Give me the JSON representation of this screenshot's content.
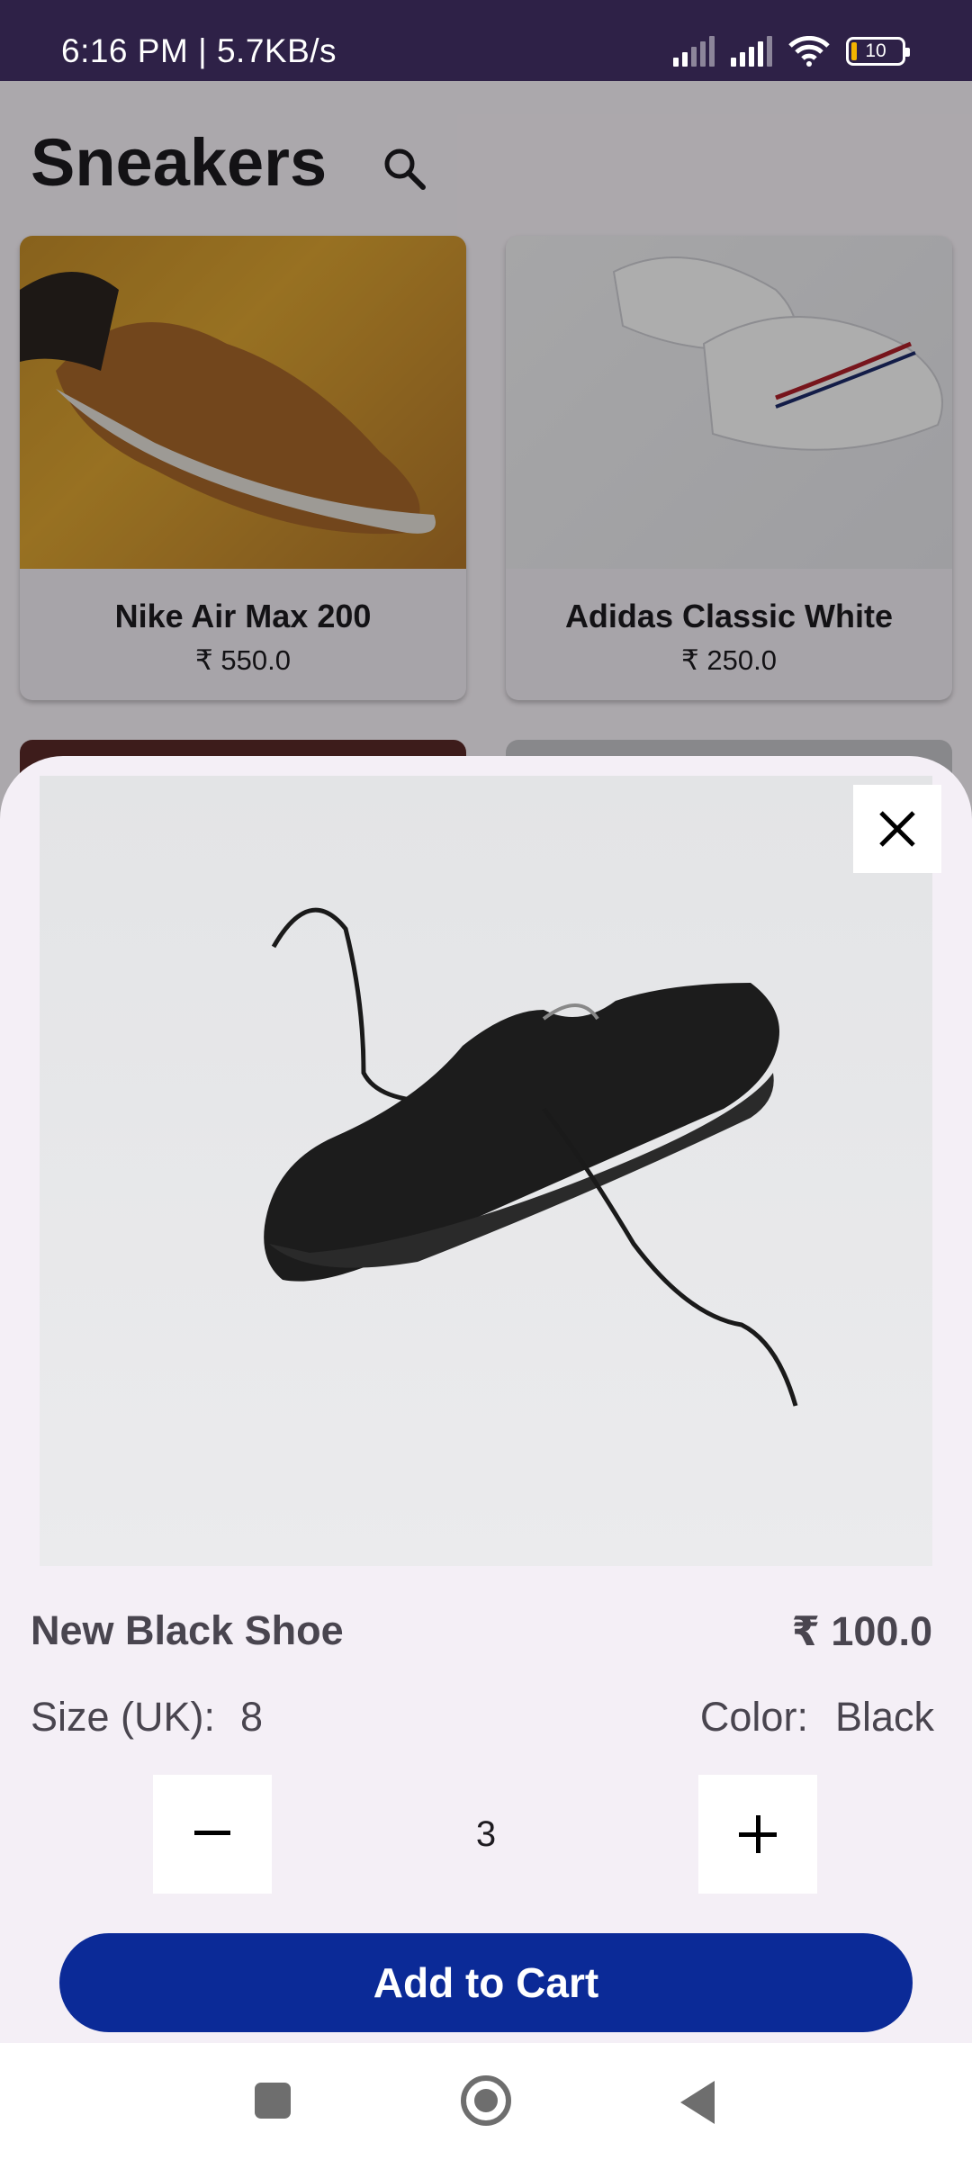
{
  "status_bar": {
    "time_speed": "6:16 PM | 5.7KB/s",
    "battery": "10"
  },
  "page": {
    "title": "Sneakers"
  },
  "products": [
    {
      "name": "Nike Air Max 200",
      "price": "₹ 550.0"
    },
    {
      "name": "Adidas Classic White",
      "price": "₹ 250.0"
    }
  ],
  "sheet": {
    "product_name": "New Black Shoe",
    "price": "₹ 100.0",
    "size_label": "Size (UK):",
    "size_value": "8",
    "color_label": "Color:",
    "color_value": "Black",
    "quantity": "3",
    "add_to_cart_label": "Add to Cart"
  },
  "colors": {
    "status_bar": "#2e2147",
    "primary_button": "#0b2a97",
    "sheet_background": "#f4eff6"
  },
  "icons": [
    "search-icon",
    "close-icon",
    "minus-icon",
    "plus-icon",
    "recents-icon",
    "home-icon",
    "back-icon"
  ]
}
